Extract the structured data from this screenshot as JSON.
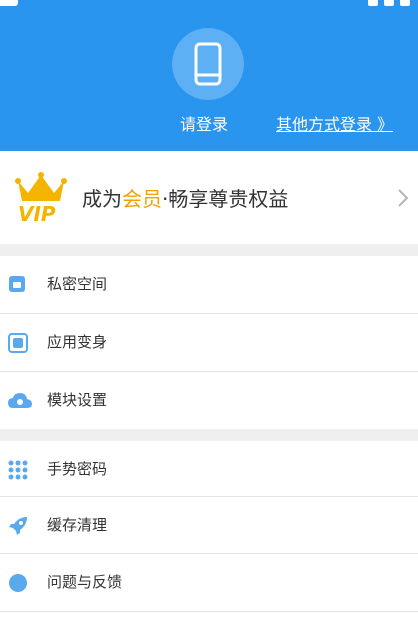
{
  "header": {
    "login_label": "请登录",
    "other_login_label": "其他方式登录 》"
  },
  "vip": {
    "prefix": "成为",
    "highlight": "会员",
    "suffix": "·畅享尊贵权益",
    "badge_text": "VIP",
    "accent_color": "#f1a200"
  },
  "menu": {
    "group1": [
      {
        "label": "私密空间",
        "icon": "lock-folder-icon"
      },
      {
        "label": "应用变身",
        "icon": "app-disguise-icon"
      },
      {
        "label": "模块设置",
        "icon": "cloud-gear-icon"
      }
    ],
    "group2": [
      {
        "label": "手势密码",
        "icon": "pattern-grid-icon"
      },
      {
        "label": "缓存清理",
        "icon": "rocket-icon"
      },
      {
        "label": "问题与反馈",
        "icon": "feedback-icon"
      }
    ]
  },
  "colors": {
    "primary": "#2a95ee",
    "icon_blue": "#5aa9ee"
  }
}
